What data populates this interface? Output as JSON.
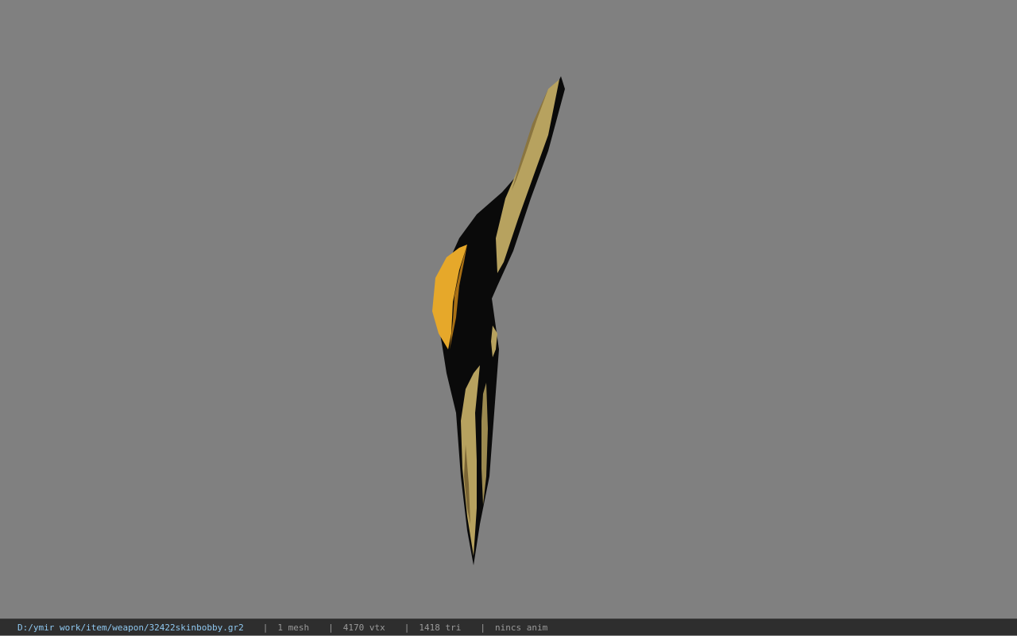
{
  "viewer": {
    "background_color": "#808080",
    "model_colors": {
      "body": "#0a0a0a",
      "blade": "#b7a25f",
      "blade_dark": "#6f5a2a",
      "guard": "#e6a82a",
      "guard_dark": "#a86f14"
    }
  },
  "statusbar": {
    "file_path": "D:/ymir work/item/weapon/32422skinbobby.gr2",
    "separator": "|",
    "mesh_count": "1 mesh",
    "vertex_count": "4170 vtx",
    "triangle_count": "1418 tri",
    "anim_status": "nincs anim",
    "path_color": "#8fc8f0",
    "text_color": "#9a9a9a",
    "background_color": "#2e2e2e"
  }
}
